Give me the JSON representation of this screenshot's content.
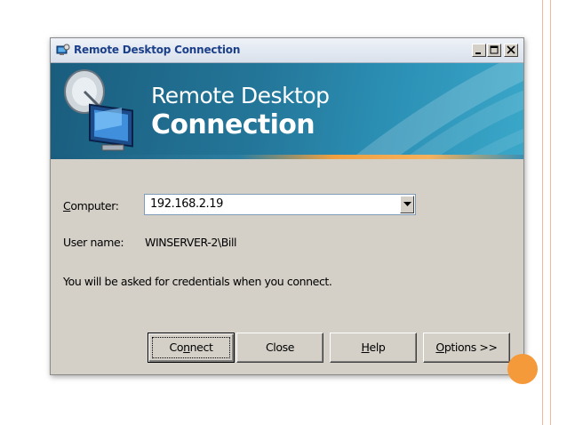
{
  "window": {
    "title": "Remote Desktop Connection",
    "icon": "remote-desktop-icon",
    "controls": {
      "minimize": "_",
      "maximize": "□",
      "close": "×"
    }
  },
  "banner": {
    "line1": "Remote Desktop",
    "line2": "Connection",
    "art": "monitor-satellite-dish-icon"
  },
  "form": {
    "computer_label_mnemonic": "C",
    "computer_label_rest": "omputer:",
    "computer_value": "192.168.2.19",
    "username_label": "User name:",
    "username_value": "WINSERVER-2\\Bill",
    "note": "You will be asked for credentials when you connect."
  },
  "buttons": {
    "connect_pre": "Co",
    "connect_mnemonic": "n",
    "connect_post": "nect",
    "close": "Close",
    "help_mnemonic": "H",
    "help_rest": "elp",
    "options_mnemonic": "O",
    "options_rest": "ptions >>"
  },
  "colors": {
    "accent_orange": "#f59a3b",
    "banner_blue": "#24779a",
    "dialog_gray": "#d4d0c8",
    "title_text": "#1c3f8a"
  }
}
